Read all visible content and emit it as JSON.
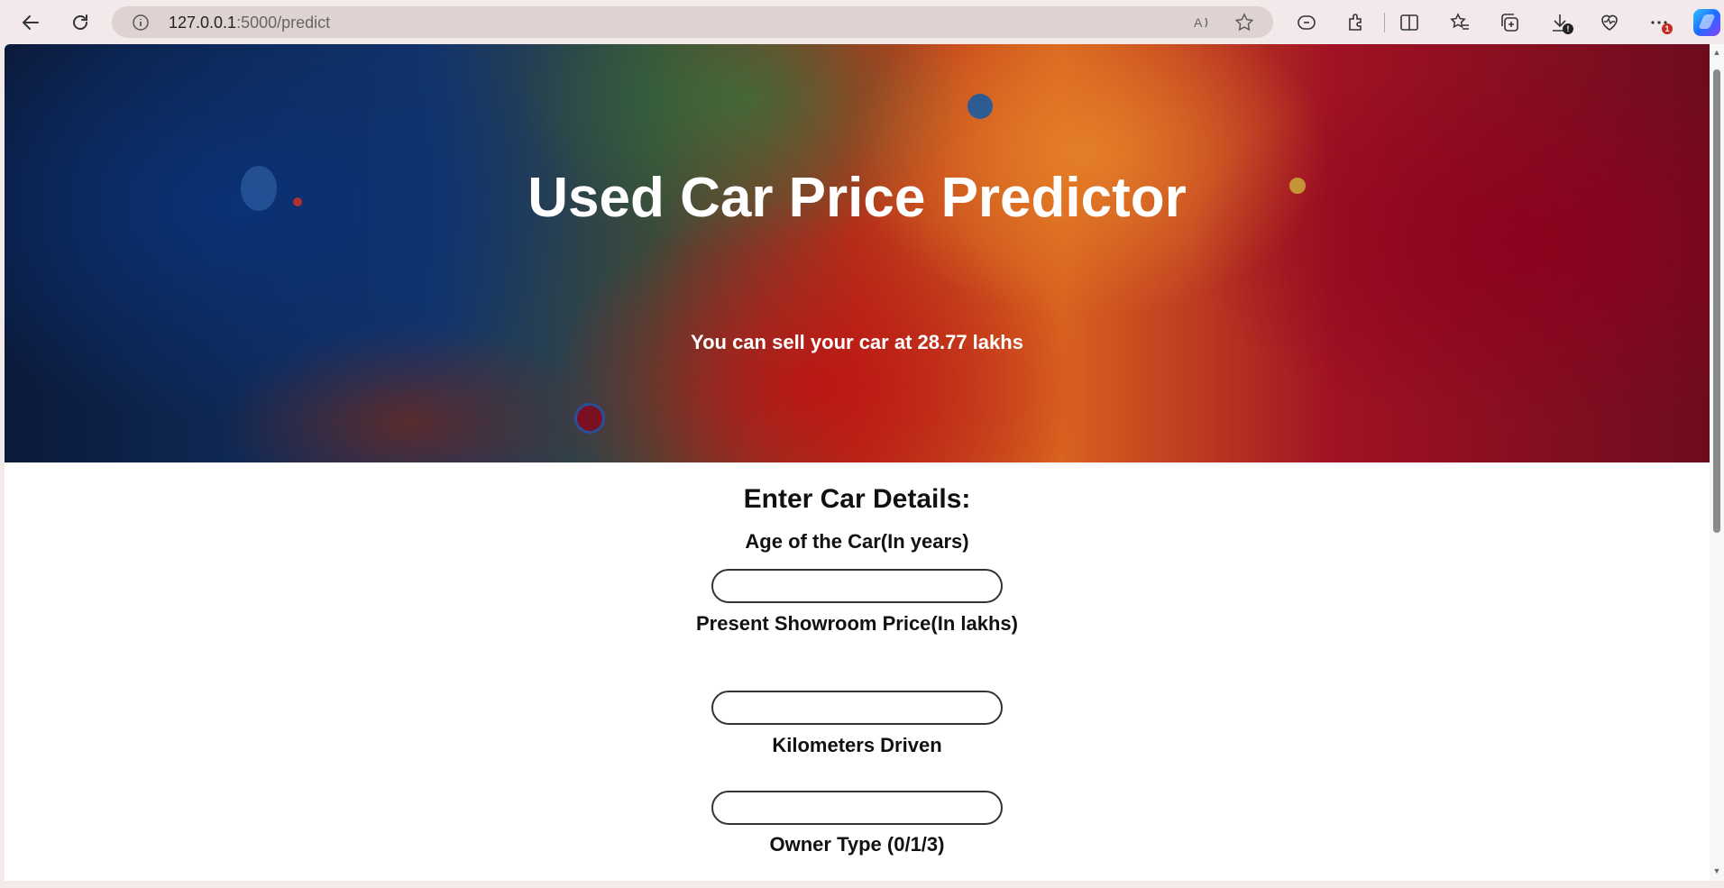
{
  "browser": {
    "url_host": "127.0.0.1",
    "url_path": ":5000/predict",
    "downloads_badge": "!",
    "more_badge": "1"
  },
  "page": {
    "title": "Used Car Price Predictor",
    "result": "You can sell your car at 28.77 lakhs",
    "form_title": "Enter Car Details:",
    "fields": [
      {
        "label": "Age of the Car(In years)",
        "value": ""
      },
      {
        "label": "Present Showroom Price(In lakhs)",
        "value": ""
      },
      {
        "label": "Kilometers Driven",
        "value": ""
      },
      {
        "label": "Owner Type (0/1/3)",
        "value": ""
      }
    ]
  },
  "colors": {
    "hero_blue": "#12346a",
    "hero_red": "#a01224",
    "hero_orange": "#d8621f"
  }
}
